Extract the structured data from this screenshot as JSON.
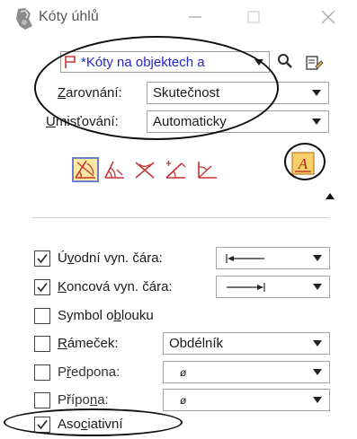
{
  "window": {
    "title": "Kóty úhlů",
    "icons": {
      "app": "dimension-tool-icon",
      "minimize": "minimize-icon",
      "maximize": "maximize-icon",
      "close": "close-icon"
    }
  },
  "level": {
    "value": "*Kóty na objektech a",
    "icon": "level-flag-icon"
  },
  "toolbar": {
    "search_icon": "search-icon",
    "edit_icon": "edit-icon"
  },
  "alignment": {
    "label_first": "Z",
    "label_rest": "arovnání:",
    "value": "Skutečnost"
  },
  "placement": {
    "label_first": "U",
    "label_rest": "misťování:",
    "value": "Automaticky"
  },
  "tools": [
    {
      "name": "tool-angle-size",
      "selected": true
    },
    {
      "name": "tool-angle-location",
      "selected": false
    },
    {
      "name": "tool-angle-lines",
      "selected": false
    },
    {
      "name": "tool-angle-x-axis",
      "selected": false
    },
    {
      "name": "tool-angle-y-axis",
      "selected": false
    }
  ],
  "style_button": {
    "icon": "dimension-style-icon",
    "letter": "A"
  },
  "options": {
    "start_ext": {
      "checked": true,
      "label_pre": "Ú",
      "label_u": "v",
      "label_post": "odní vyn. čára:",
      "value": "|←——"
    },
    "end_ext": {
      "checked": true,
      "label_pre": "",
      "label_u": "K",
      "label_post": "oncová vyn. čára:",
      "value": "——→|"
    },
    "arc_symbol": {
      "checked": false,
      "label_pre": "Symbol o",
      "label_u": "b",
      "label_post": "louku"
    },
    "frame": {
      "checked": false,
      "label_pre": "",
      "label_u": "R",
      "label_post": "ámeček:",
      "value": "Obdélník"
    },
    "prefix": {
      "checked": false,
      "label_pre": "P",
      "label_u": "ř",
      "label_post": "edpona:",
      "value": "ø"
    },
    "suffix": {
      "checked": false,
      "label_pre": "Přípo",
      "label_u": "n",
      "label_post": "a:",
      "value": "ø"
    },
    "associative": {
      "checked": true,
      "label_pre": "Aso",
      "label_u": "c",
      "label_post": "iativní"
    }
  },
  "colors": {
    "accent_blue": "#2727c8",
    "selected_fill": "#fbeaa0",
    "tool_red": "#c83232"
  }
}
